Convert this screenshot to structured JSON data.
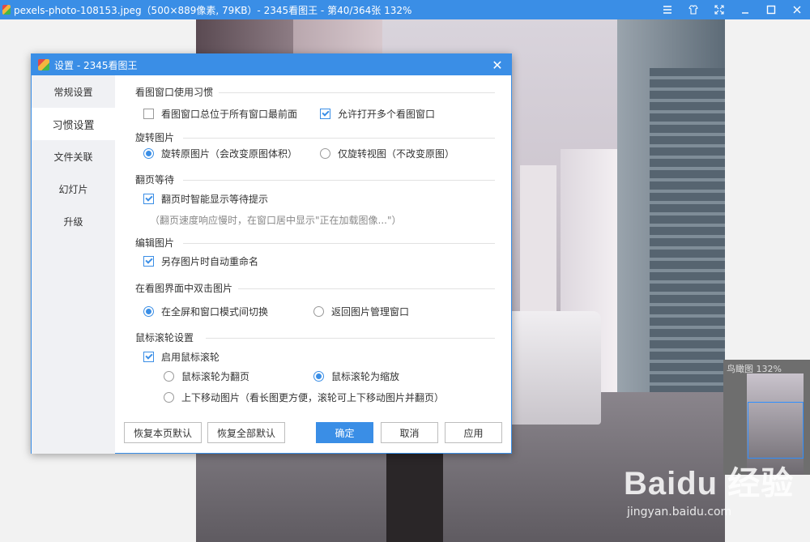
{
  "window": {
    "title": "pexels-photo-108153.jpeg（500×889像素, 79KB）- 2345看图王 - 第40/364张 132%"
  },
  "birdseye": {
    "label": "鸟瞰图 132%"
  },
  "watermark": {
    "logo": "Baidu 经验",
    "url": "jingyan.baidu.com"
  },
  "dialog": {
    "title": "设置 - 2345看图王",
    "nav": [
      "常规设置",
      "习惯设置",
      "文件关联",
      "幻灯片",
      "升级"
    ],
    "active_nav": 1,
    "sections": {
      "window_habit": {
        "title": "看图窗口使用习惯",
        "opt_always_top": "看图窗口总位于所有窗口最前面",
        "opt_multi_window": "允许打开多个看图窗口"
      },
      "rotate": {
        "title": "旋转图片",
        "opt_rotate_original": "旋转原图片（会改变原图体积）",
        "opt_rotate_view": "仅旋转视图（不改变原图）"
      },
      "page_wait": {
        "title": "翻页等待",
        "opt_smart_hint": "翻页时智能显示等待提示",
        "hint": "（翻页速度响应慢时，在窗口居中显示\"正在加载图像...\"）"
      },
      "edit": {
        "title": "编辑图片",
        "opt_auto_rename": "另存图片时自动重命名"
      },
      "dblclick": {
        "title": "在看图界面中双击图片",
        "opt_toggle_fullscreen": "在全屏和窗口模式间切换",
        "opt_return_manager": "返回图片管理窗口"
      },
      "wheel": {
        "title": "鼠标滚轮设置",
        "opt_enable_wheel": "启用鼠标滚轮",
        "opt_wheel_page": "鼠标滚轮为翻页",
        "opt_wheel_zoom": "鼠标滚轮为缩放",
        "opt_wheel_move": "上下移动图片（看长图更方便，滚轮可上下移动图片并翻页）"
      }
    },
    "buttons": {
      "restore_page": "恢复本页默认",
      "restore_all": "恢复全部默认",
      "ok": "确定",
      "cancel": "取消",
      "apply": "应用"
    }
  },
  "colors": {
    "accent": "#3a8ee6"
  }
}
